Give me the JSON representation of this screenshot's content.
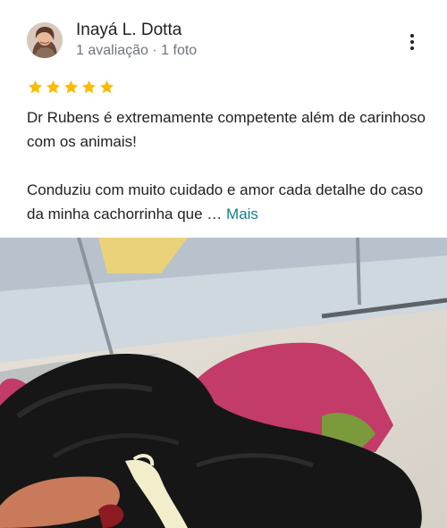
{
  "author": {
    "name": "Inayá L. Dotta",
    "meta": "1 avaliação · 1 foto"
  },
  "rating": {
    "stars": 5,
    "max": 5,
    "color": "#fbbc04"
  },
  "review": {
    "paragraph1": "Dr Rubens é extremamente competente além de carinhoso com os animais!",
    "paragraph2": "Conduziu com muito cuidado e amor cada detalhe do caso da minha cachorrinha que …",
    "more_label": "Mais"
  },
  "icons": {
    "more": "more-vertical-icon",
    "star": "star-icon"
  },
  "colors": {
    "link": "#167c8c",
    "meta_text": "#70757a"
  }
}
